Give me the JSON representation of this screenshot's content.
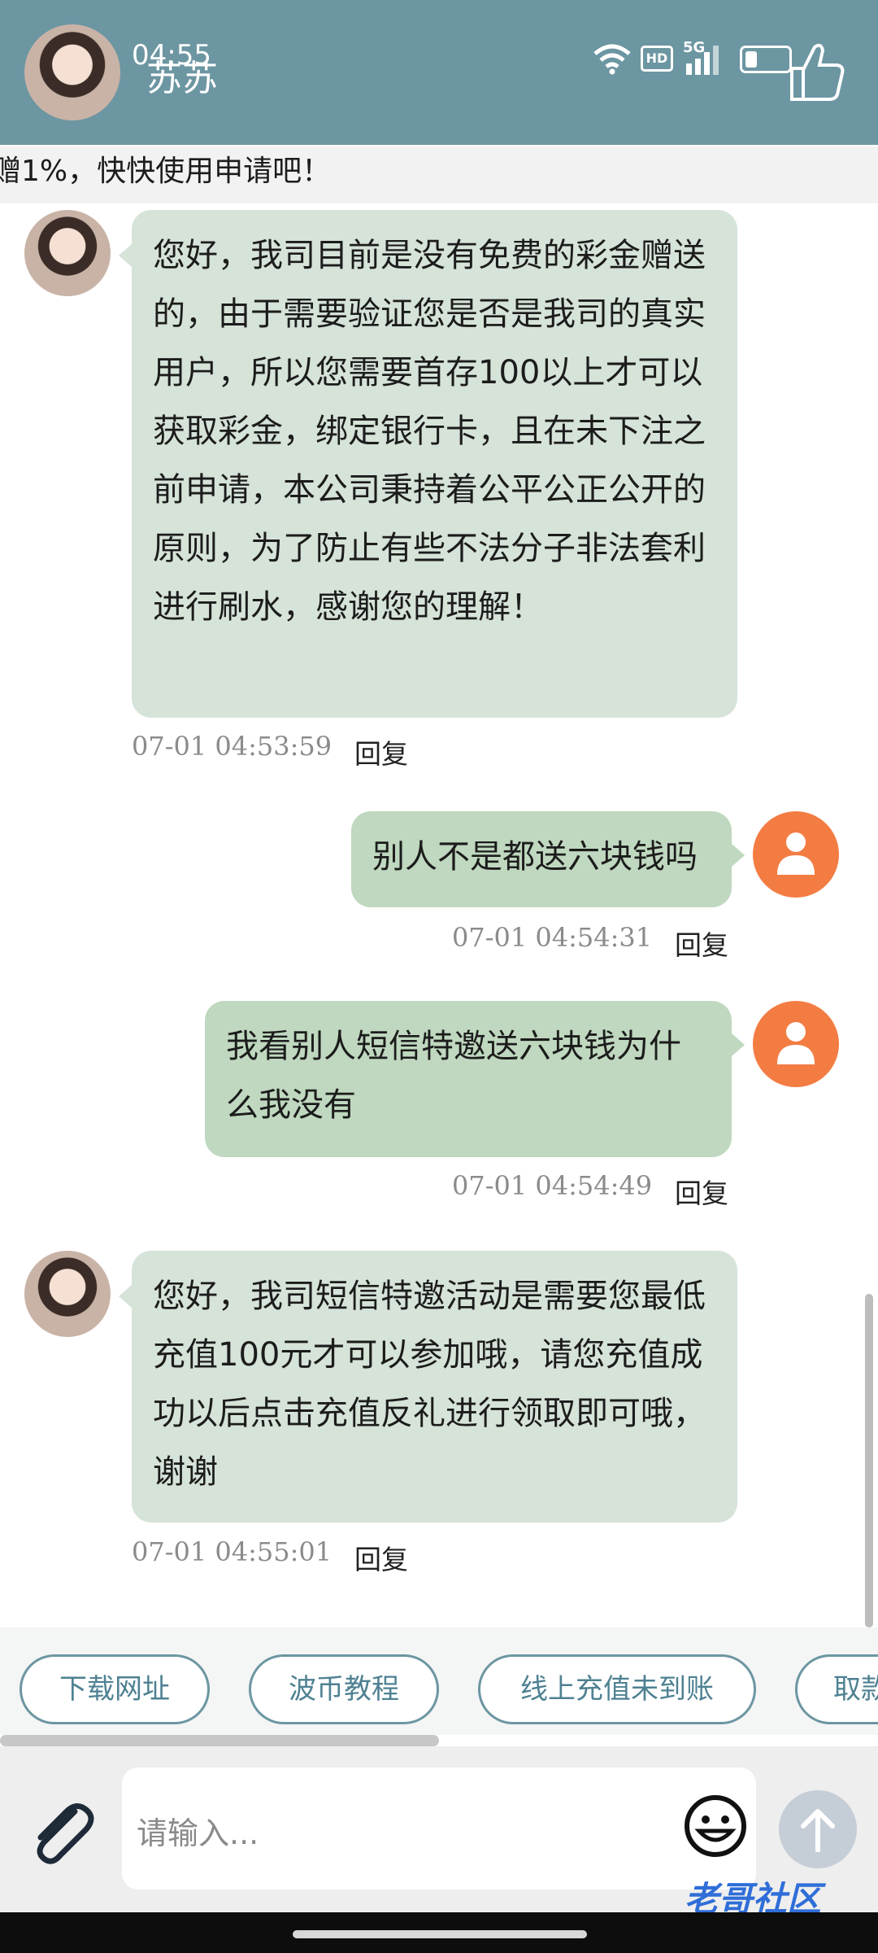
{
  "status_bar": {
    "time": "04:55",
    "network": "5G"
  },
  "header": {
    "contact_name": "苏苏",
    "hd_badge": "HD"
  },
  "notice": {
    "text": "赠1%，快快使用申请吧！"
  },
  "messages": [
    {
      "sender": "agent",
      "text": "您好，我司目前是没有免费的彩金赠送的，由于需要验证您是否是我司的真实用户，所以您需要首存100以上才可以获取彩金，绑定银行卡，且在未下注之前申请，本公司秉持着公平公正公开的原则，为了防止有些不法分子非法套利进行刷水，感谢您的理解！",
      "timestamp": "07-01 04:53:59",
      "reply_label": "回复"
    },
    {
      "sender": "user",
      "text": "别人不是都送六块钱吗",
      "timestamp": "07-01 04:54:31",
      "reply_label": "回复"
    },
    {
      "sender": "user",
      "text": "我看别人短信特邀送六块钱为什么我没有",
      "timestamp": "07-01 04:54:49",
      "reply_label": "回复"
    },
    {
      "sender": "agent",
      "text": "您好，我司短信特邀活动是需要您最低充值100元才可以参加哦，请您充值成功以后点击充值反礼进行领取即可哦，谢谢",
      "timestamp": "07-01 04:55:01",
      "reply_label": "回复"
    }
  ],
  "quick_replies": [
    "下载网址",
    "波币教程",
    "线上充值未到账",
    "取款"
  ],
  "input": {
    "placeholder": "请输入..."
  },
  "watermark": "老哥社区",
  "colors": {
    "header": "#6c96a2",
    "agent_bubble": "#d6e3d8",
    "user_bubble": "#bfd8bf",
    "user_avatar": "#f37c43",
    "chip_border": "#6c96a2"
  }
}
